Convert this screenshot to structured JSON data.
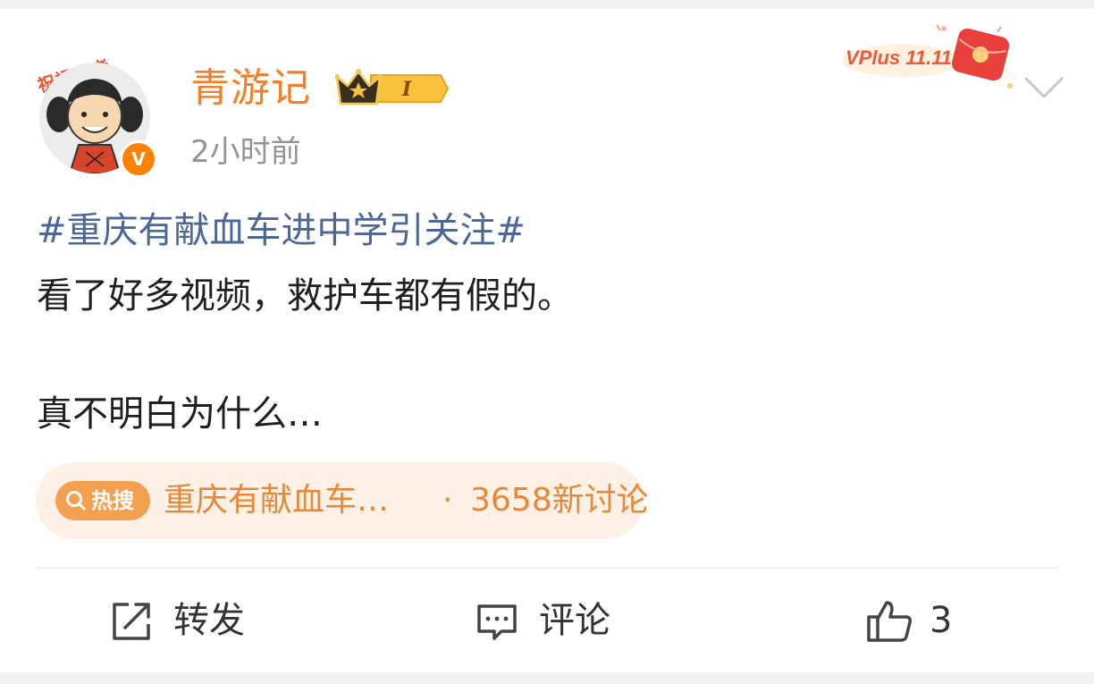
{
  "post": {
    "author": {
      "name": "青游记",
      "avatar_caption": "祝福高考",
      "verified_mark": "V",
      "vip_level": "I"
    },
    "timestamp": "2小时前",
    "promo_label": "VPlus 11.11",
    "hashtag": "#重庆有献血车进中学引关注#",
    "body_line_1": "看了好多视频，救护车都有假的。",
    "body_line_2": "真不明白为什么…"
  },
  "trend": {
    "tag_label": "热搜",
    "title": "重庆有献血车…",
    "separator": "·",
    "count": "3658新讨论"
  },
  "actions": {
    "repost_label": "转发",
    "comment_label": "评论",
    "like_count": "3"
  },
  "colors": {
    "username": "#f37f2a",
    "hashtag": "#4a6795",
    "trend_text": "#e6883a",
    "trend_bg": "#fdf0e4",
    "verified": "#ff8200"
  },
  "icons": [
    "verified-icon",
    "crown-icon",
    "chevron-down-icon",
    "search-icon",
    "repost-icon",
    "comment-icon",
    "thumbs-up-icon"
  ]
}
